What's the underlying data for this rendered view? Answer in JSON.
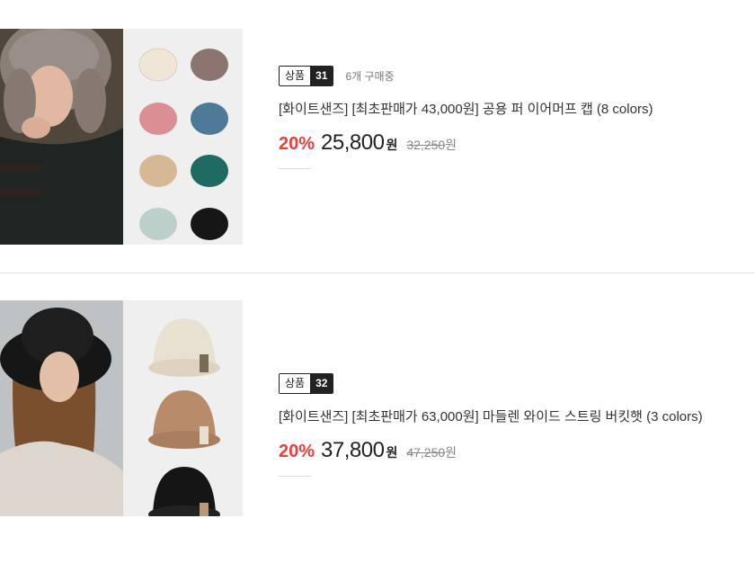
{
  "products": [
    {
      "tag_label": "상품",
      "tag_number": "31",
      "buyers_text": "6개 구매중",
      "title": "[화이트샌즈] [최초판매가 43,000원] 공용 퍼 이어머프 캡 (8 colors)",
      "discount": "20%",
      "price": "25,800",
      "currency": "원",
      "original_price": "32,250",
      "image_desc": "earmuff-cap-photo",
      "swatch_colors": [
        "#efe6d8",
        "#8c7570",
        "#d98f93",
        "#4f7a97",
        "#d7b894",
        "#1f6a63",
        "#bccfca",
        "#161616"
      ]
    },
    {
      "tag_label": "상품",
      "tag_number": "32",
      "title": "[화이트샌즈] [최초판매가 63,000원] 마들렌 와이드 스트링 버킷햇 (3 colors)",
      "discount": "20%",
      "price": "37,800",
      "currency": "원",
      "original_price": "47,250",
      "image_desc": "bucket-hat-photo",
      "swatch_colors": [
        "#e8e0d0",
        "#b88c6a",
        "#151515"
      ]
    }
  ],
  "colors": {
    "discount": "#e8413c",
    "tag_dark": "#222222"
  }
}
